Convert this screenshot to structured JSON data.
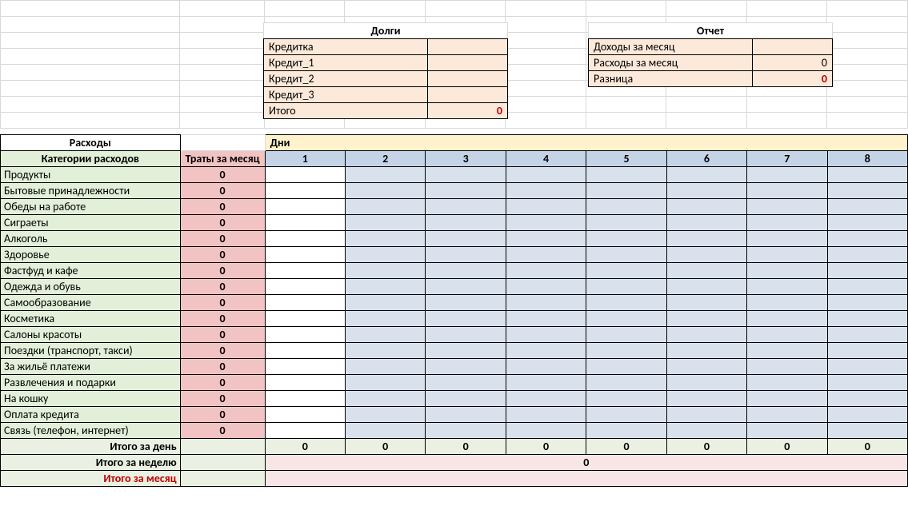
{
  "debts": {
    "title": "Долги",
    "rows": [
      {
        "label": "Кредитка",
        "value": ""
      },
      {
        "label": "Кредит_1",
        "value": ""
      },
      {
        "label": "Кредит_2",
        "value": ""
      },
      {
        "label": "Кредит_3",
        "value": ""
      }
    ],
    "total_label": "Итого",
    "total_value": "0"
  },
  "report": {
    "title": "Отчет",
    "rows": [
      {
        "label": "Доходы за месяц",
        "value": ""
      },
      {
        "label": "Расходы за месяц",
        "value": "0"
      },
      {
        "label": "Разница",
        "value": "0",
        "red": true
      }
    ]
  },
  "expenses": {
    "title": "Расходы",
    "categories_header": "Категории расходов",
    "month_header": "Траты за месяц",
    "days_title": "Дни",
    "days": [
      "1",
      "2",
      "3",
      "4",
      "5",
      "6",
      "7",
      "8"
    ],
    "categories": [
      "Продукты",
      "Бытовые принадлежности",
      "Обеды на работе",
      "Сиграеты",
      "Алкоголь",
      "Здоровье",
      "Фастфуд и кафе",
      "Одежда и обувь",
      "Самообразование",
      "Косметика",
      "Салоны красоты",
      "Поездки (транспорт, такси)",
      "За жильё платежи",
      "Развлечения и подарки",
      "На кошку",
      "Оплата кредита",
      "Связь (телефон, интернет)"
    ],
    "month_total_value": "0",
    "day_total_label": "Итого за день",
    "day_totals": [
      "0",
      "0",
      "0",
      "0",
      "0",
      "0",
      "0",
      "0"
    ],
    "week_total_label": "Итого за неделю",
    "week_total_value": "0",
    "month_total_label": "Итого за месяц"
  }
}
